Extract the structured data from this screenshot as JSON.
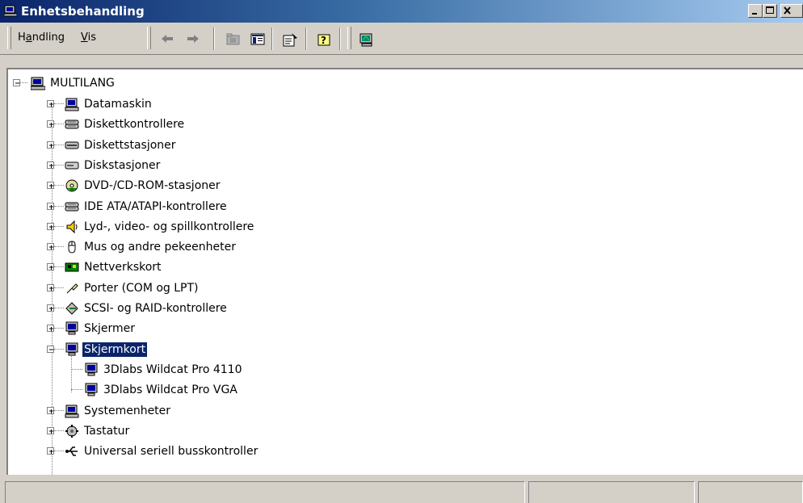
{
  "window": {
    "title": "Enhetsbehandling",
    "icon": "device-manager-icon",
    "controls": [
      "minimize-icon",
      "maximize-icon",
      "close-icon"
    ]
  },
  "menu": {
    "action": {
      "accel": "a",
      "pre": "H",
      "rest": "ndling"
    },
    "view": {
      "accel": "V",
      "rest": "is"
    }
  },
  "toolbar_icons": [
    "back-arrow-icon",
    "forward-arrow-icon",
    "up-folder-icon",
    "show-hide-tree-icon",
    "properties-icon",
    "help-icon",
    "scan-hardware-icon"
  ],
  "tree": {
    "root": "MULTILANG",
    "items": [
      {
        "label": "Datamaskin",
        "icon": "computer-icon",
        "expanded": false
      },
      {
        "label": "Diskettkontrollere",
        "icon": "floppy-controller-icon",
        "expanded": false
      },
      {
        "label": "Diskettstasjoner",
        "icon": "floppy-drive-icon",
        "expanded": false
      },
      {
        "label": "Diskstasjoner",
        "icon": "disk-drive-icon",
        "expanded": false
      },
      {
        "label": "DVD-/CD-ROM-stasjoner",
        "icon": "cdrom-icon",
        "expanded": false
      },
      {
        "label": "IDE ATA/ATAPI-kontrollere",
        "icon": "ide-controller-icon",
        "expanded": false
      },
      {
        "label": "Lyd-, video- og spillkontrollere",
        "icon": "speaker-icon",
        "expanded": false
      },
      {
        "label": "Mus og andre pekeenheter",
        "icon": "mouse-icon",
        "expanded": false
      },
      {
        "label": "Nettverkskort",
        "icon": "network-card-icon",
        "expanded": false
      },
      {
        "label": "Porter (COM og LPT)",
        "icon": "port-icon",
        "expanded": false
      },
      {
        "label": "SCSI- og RAID-kontrollere",
        "icon": "scsi-icon",
        "expanded": false
      },
      {
        "label": "Skjermer",
        "icon": "monitor-icon",
        "expanded": false
      },
      {
        "label": "Skjermkort",
        "icon": "display-adapter-icon",
        "expanded": true,
        "selected": true
      },
      {
        "label": "Systemenheter",
        "icon": "system-devices-icon",
        "expanded": false
      },
      {
        "label": "Tastatur",
        "icon": "keyboard-icon",
        "expanded": false
      },
      {
        "label": "Universal seriell busskontroller",
        "icon": "usb-icon",
        "expanded": false
      }
    ],
    "children": [
      "3Dlabs Wildcat Pro 4110",
      "3Dlabs Wildcat Pro VGA"
    ]
  },
  "colors": {
    "title_start": "#0a246a",
    "title_end": "#a6caf0",
    "selection": "#0a246a",
    "face": "#d4d0c8"
  }
}
